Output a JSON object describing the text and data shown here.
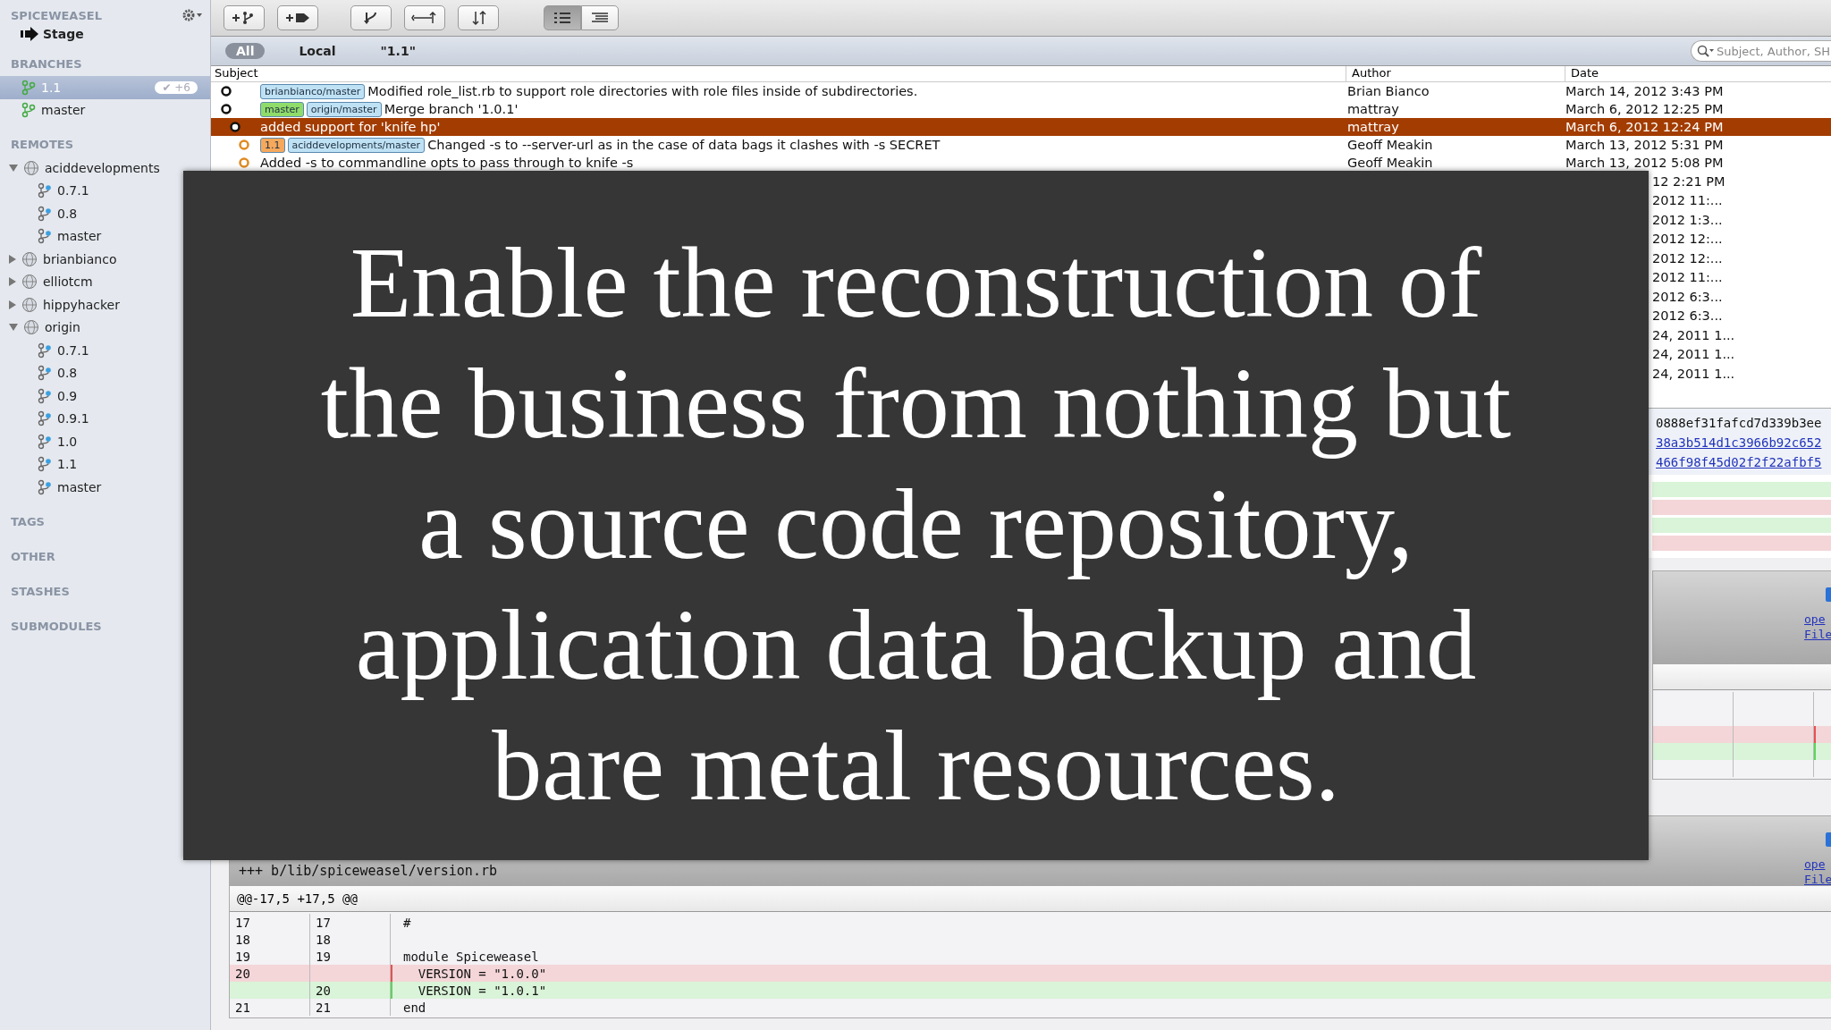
{
  "sidebar": {
    "title": "SPICEWEASEL",
    "stage": "Stage",
    "sections": [
      {
        "title": "BRANCHES",
        "items": [
          {
            "kind": "branch",
            "label": "1.1",
            "selected": true,
            "badge": "✔ +6"
          },
          {
            "kind": "branch",
            "label": "master",
            "selected": false
          }
        ]
      },
      {
        "title": "REMOTES",
        "items": [
          {
            "kind": "remote",
            "label": "aciddevelopments",
            "expanded": true,
            "selected": false,
            "children": [
              {
                "kind": "remote-branch",
                "label": "0.7.1",
                "selected": false
              },
              {
                "kind": "remote-branch",
                "label": "0.8",
                "selected": false
              },
              {
                "kind": "remote-branch",
                "label": "master",
                "selected": false
              }
            ]
          },
          {
            "kind": "remote",
            "label": "brianbianco",
            "expanded": false,
            "selected": false
          },
          {
            "kind": "remote",
            "label": "elliotcm",
            "expanded": false,
            "selected": false
          },
          {
            "kind": "remote",
            "label": "hippyhacker",
            "expanded": false,
            "selected": false
          },
          {
            "kind": "remote",
            "label": "origin",
            "expanded": true,
            "selected": false,
            "children": [
              {
                "kind": "remote-branch",
                "label": "0.7.1",
                "selected": false
              },
              {
                "kind": "remote-branch",
                "label": "0.8",
                "selected": false
              },
              {
                "kind": "remote-branch",
                "label": "0.9",
                "selected": false
              },
              {
                "kind": "remote-branch",
                "label": "0.9.1",
                "selected": false
              },
              {
                "kind": "remote-branch",
                "label": "1.0",
                "selected": false
              },
              {
                "kind": "remote-branch",
                "label": "1.1",
                "selected": false
              },
              {
                "kind": "remote-branch",
                "label": "master",
                "selected": false
              }
            ]
          }
        ]
      },
      {
        "title": "TAGS"
      },
      {
        "title": "OTHER"
      },
      {
        "title": "STASHES"
      },
      {
        "title": "SUBMODULES"
      }
    ]
  },
  "toolbar": {
    "buttons": [
      {
        "kind": "add-branch"
      },
      {
        "kind": "add-tag"
      },
      {
        "kind": "merge"
      },
      {
        "kind": "cherry-pick"
      },
      {
        "kind": "rebase"
      }
    ],
    "view_modes": [
      {
        "kind": "list",
        "selected": true
      },
      {
        "kind": "detail",
        "selected": false
      }
    ]
  },
  "scope": [
    {
      "label": "All",
      "selected": true
    },
    {
      "label": "Local",
      "selected": false
    },
    {
      "label": "\"1.1\"",
      "selected": false
    }
  ],
  "search": {
    "placeholder": "Subject, Author, SH"
  },
  "commits": {
    "columns": [
      "Subject",
      "Author",
      "Date"
    ],
    "rows": [
      {
        "kind": "main",
        "refs": [
          {
            "label": "brianbianco/master",
            "color": "#bfe1f4"
          }
        ],
        "subject": "Modified role_list.rb to support role directories with role files inside of subdirectories.",
        "author": "Brian Bianco",
        "date": "March 14, 2012 3:43 PM",
        "selected": false
      },
      {
        "kind": "main",
        "refs": [
          {
            "label": "master",
            "color": "#8fdc6a"
          },
          {
            "label": "origin/master",
            "color": "#bfe1f4"
          }
        ],
        "subject": "Merge branch '1.0.1'",
        "author": "mattray",
        "date": "March 6, 2012 12:25 PM",
        "selected": false
      },
      {
        "kind": "side",
        "refs": [],
        "subject": "added support for 'knife hp'",
        "author": "mattray",
        "date": "March 6, 2012 12:24 PM",
        "selected": true
      },
      {
        "kind": "branch",
        "refs": [
          {
            "label": "1.1",
            "color": "#f6a95c"
          },
          {
            "label": "aciddevelopments/master",
            "color": "#bfe1f4"
          }
        ],
        "subject": "Changed -s to --server-url as in the case of data bags it clashes with -s SECRET",
        "author": "Geoff Meakin",
        "date": "March 13, 2012 5:31 PM",
        "selected": false
      },
      {
        "kind": "branch",
        "refs": [],
        "subject": "Added -s to commandline opts to pass through to knife -s",
        "author": "Geoff Meakin",
        "date": "March 13, 2012 5:08 PM",
        "selected": false
      }
    ],
    "date_fragments": [
      "12 2:21 PM",
      "2012 11:...",
      "2012 1:3...",
      "2012 12:...",
      "2012 12:...",
      "2012 11:...",
      "2012 6:3...",
      "2012 6:3...",
      "24, 2011 1...",
      "24, 2011 1...",
      "24, 2011 1..."
    ]
  },
  "detail": {
    "sha_fragments": [
      {
        "kind": "text",
        "text": "0888ef31fafcd7d339b3ee"
      },
      {
        "kind": "link",
        "text": "38a3b514d1c3966b92c652"
      },
      {
        "kind": "link",
        "text": "466f98f45d02f2f22afbf5"
      }
    ],
    "changed_files": [
      {
        "kind": "added"
      },
      {
        "kind": "removed"
      },
      {
        "kind": "added"
      },
      {
        "kind": "removed"
      }
    ],
    "file_blocks": [
      {
        "links": [
          "ope",
          "File"
        ],
        "lines": [
          {
            "kind": "context"
          },
          {
            "kind": "context"
          },
          {
            "kind": "removed"
          },
          {
            "kind": "added"
          },
          {
            "kind": "context"
          }
        ]
      },
      {
        "header_lines": [
          "+++ b/lib/spiceweasel/version.rb"
        ],
        "links": [
          "ope",
          "File"
        ],
        "hunk": "@@-17,5 +17,5 @@",
        "lines": [
          {
            "kind": "context",
            "old": "17",
            "new": "17",
            "code": "#"
          },
          {
            "kind": "context",
            "old": "18",
            "new": "18"
          },
          {
            "kind": "context",
            "old": "19",
            "new": "19",
            "code": "module Spiceweasel"
          },
          {
            "kind": "removed",
            "old": "20",
            "code": "  VERSION = \"1.0.0\""
          },
          {
            "kind": "added",
            "new": "20",
            "code": "  VERSION = \"1.0.1\""
          },
          {
            "kind": "context",
            "old": "21",
            "new": "21",
            "code": "end"
          }
        ]
      }
    ]
  },
  "caption": "Enable the reconstruction of the business from nothing but a source code repository, application data backup and bare metal resources."
}
